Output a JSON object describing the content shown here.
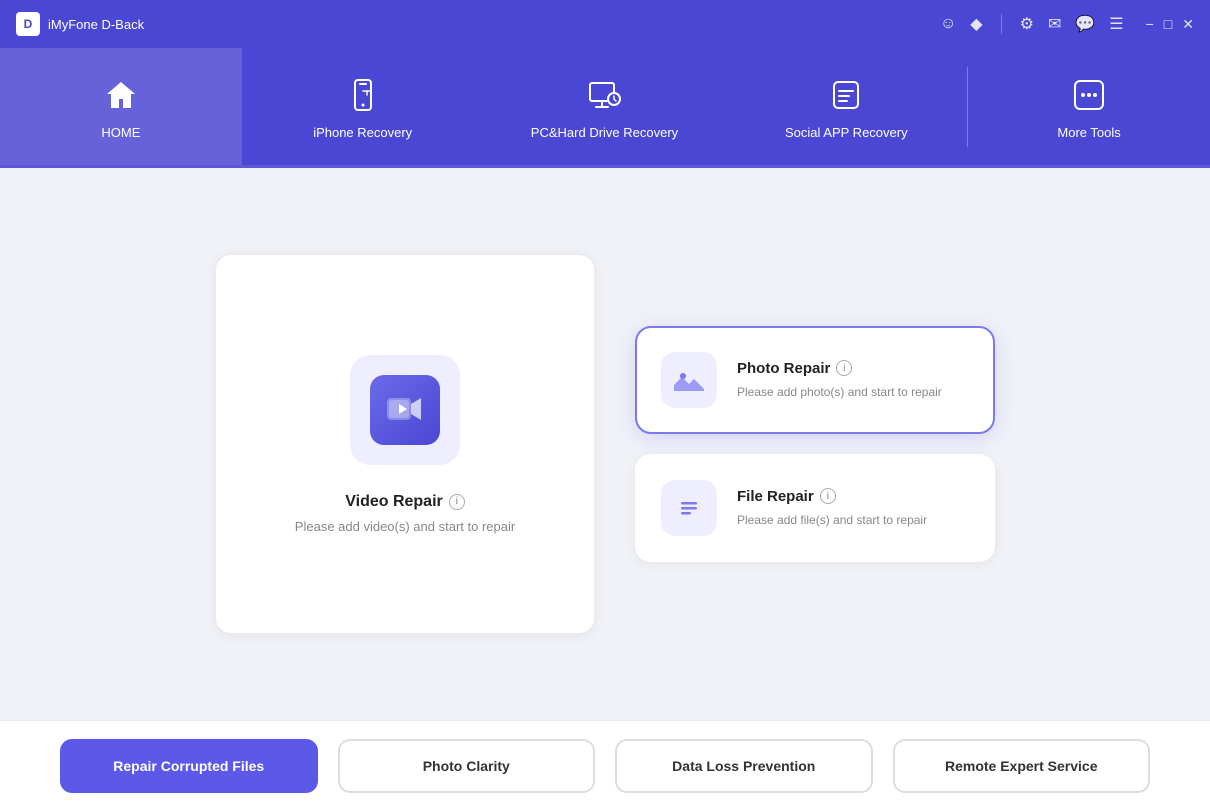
{
  "titlebar": {
    "logo": "D",
    "title": "iMyFone D-Back"
  },
  "nav": {
    "items": [
      {
        "id": "home",
        "label": "HOME",
        "icon": "home"
      },
      {
        "id": "iphone",
        "label": "iPhone Recovery",
        "icon": "iphone"
      },
      {
        "id": "pc",
        "label": "PC&Hard Drive Recovery",
        "icon": "pc"
      },
      {
        "id": "social",
        "label": "Social APP Recovery",
        "icon": "social"
      },
      {
        "id": "more",
        "label": "More Tools",
        "icon": "more"
      }
    ]
  },
  "main": {
    "left_card": {
      "title": "Video Repair",
      "desc": "Please add video(s) and start to repair"
    },
    "right_cards": [
      {
        "id": "photo",
        "title": "Photo Repair",
        "desc": "Please add photo(s) and start to repair",
        "selected": true
      },
      {
        "id": "file",
        "title": "File Repair",
        "desc": "Please add file(s) and start to repair",
        "selected": false
      }
    ]
  },
  "bottom": {
    "buttons": [
      {
        "id": "repair",
        "label": "Repair Corrupted Files",
        "active": true
      },
      {
        "id": "clarity",
        "label": "Photo Clarity",
        "active": false
      },
      {
        "id": "prevention",
        "label": "Data Loss Prevention",
        "active": false
      },
      {
        "id": "remote",
        "label": "Remote Expert Service",
        "active": false
      }
    ]
  }
}
